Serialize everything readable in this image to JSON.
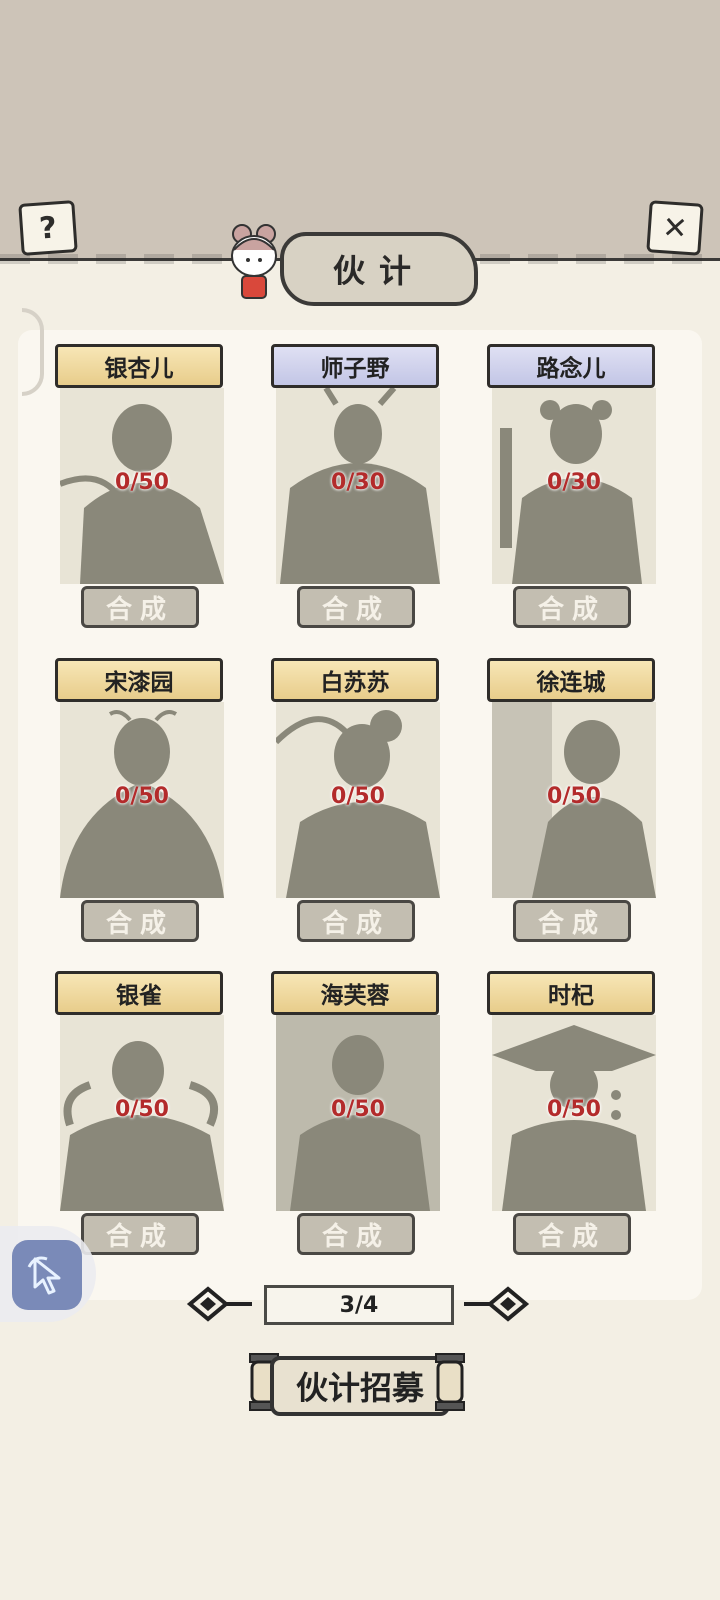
{
  "header": {
    "title": "伙计"
  },
  "toolbar": {
    "help_glyph": "?",
    "close_glyph": "✕"
  },
  "colors": {
    "count_red": "#b32b2b",
    "gold_plate": "#f0dba0",
    "blue_plate": "#cfd1ec",
    "silhouette": "#8a887a"
  },
  "partners": [
    {
      "name": "银杏儿",
      "count": "0/50",
      "plate": "gold",
      "button": "合成"
    },
    {
      "name": "师子野",
      "count": "0/30",
      "plate": "blue",
      "button": "合成"
    },
    {
      "name": "路念儿",
      "count": "0/30",
      "plate": "blue",
      "button": "合成"
    },
    {
      "name": "宋漆园",
      "count": "0/50",
      "plate": "gold",
      "button": "合成"
    },
    {
      "name": "白苏苏",
      "count": "0/50",
      "plate": "gold",
      "button": "合成"
    },
    {
      "name": "徐连城",
      "count": "0/50",
      "plate": "gold",
      "button": "合成"
    },
    {
      "name": "银雀",
      "count": "0/50",
      "plate": "gold",
      "button": "合成"
    },
    {
      "name": "海芙蓉",
      "count": "0/50",
      "plate": "gold",
      "button": "合成"
    },
    {
      "name": "时杞",
      "count": "0/50",
      "plate": "gold",
      "button": "合成"
    }
  ],
  "pagination": {
    "label": "3/4"
  },
  "recruit": {
    "label": "伙计招募"
  }
}
